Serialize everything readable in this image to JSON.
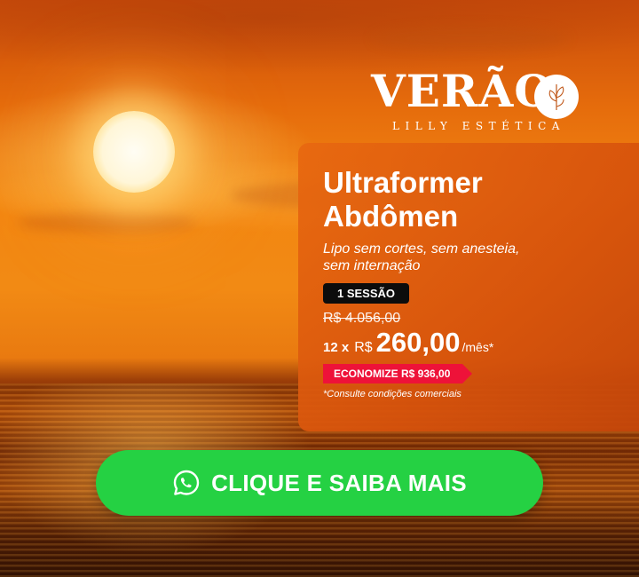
{
  "brand": {
    "name": "VERÃO",
    "subtitle": "LILLY ESTÉTICA"
  },
  "offer": {
    "title_line1": "Ultraformer",
    "title_line2": "Abdômen",
    "subtitle": "Lipo sem cortes, sem anesteia, sem internação",
    "session_badge": "1 SESSÃO",
    "old_price": "R$ 4.056,00",
    "installments": "12 x",
    "currency": "R$",
    "amount": "260,00",
    "per": "/mês*",
    "savings": "ECONOMIZE R$ 936,00",
    "disclaimer": "*Consulte condições comerciais"
  },
  "cta": {
    "label": "CLIQUE E SAIBA MAIS",
    "icon": "whatsapp-icon"
  },
  "colors": {
    "cta_green": "#25d143",
    "savings_red": "#ee1239",
    "badge_black": "#0c0c0c",
    "card_orange": "#e06812"
  }
}
